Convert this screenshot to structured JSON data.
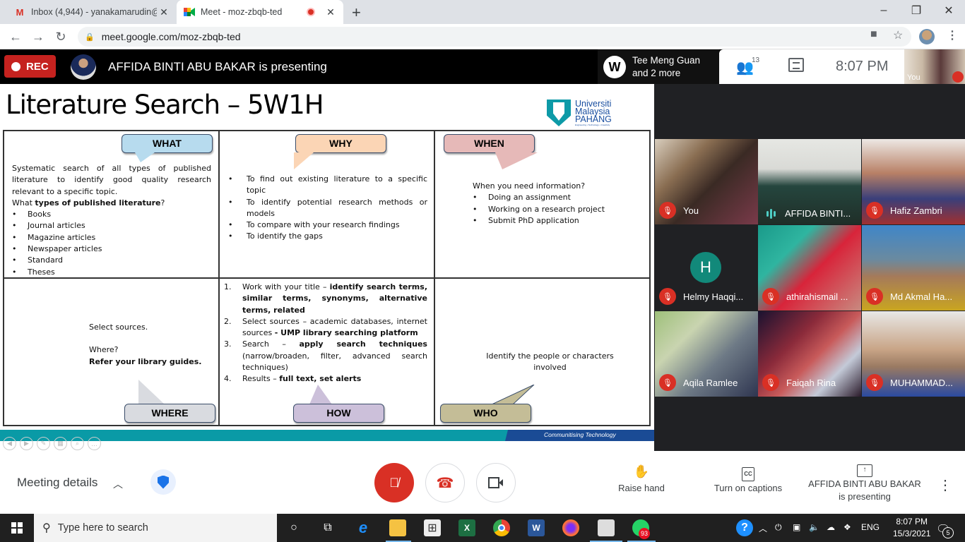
{
  "browser": {
    "tabs": [
      {
        "title": "Inbox (4,944) - yanakamarudin@",
        "icon": "gmail-icon",
        "active": false
      },
      {
        "title": "Meet - moz-zbqb-ted",
        "icon": "meet-icon",
        "active": true,
        "recording": true
      }
    ],
    "new_tab": "+",
    "url": "meet.google.com/moz-zbqb-ted",
    "window_controls": {
      "minimize": "–",
      "restore": "❐",
      "close": "✕"
    }
  },
  "meet": {
    "rec_label": "REC",
    "presenting_banner": "AFFIDA BINTI ABU BAKAR is presenting",
    "owner": {
      "name_line1": "Tee Meng Guan",
      "name_line2": "and 2 more"
    },
    "people_count": "13",
    "time": "8:07  PM",
    "self_label": "You",
    "participants": [
      {
        "name": "You",
        "muted": true,
        "bg": "linear-gradient(135deg,#d8cdbd 0%,#8a6e52 30%,#3a2a24 55%,#7a3a4a 100%)"
      },
      {
        "name": "AFFIDA BINTI...",
        "muted": false,
        "speaking": true,
        "bg": "linear-gradient(180deg,#e6e7e3 0%,#d9dad6 35%,#25463e 55%,#1f2e28 100%)"
      },
      {
        "name": "Hafiz Zambri",
        "muted": true,
        "bg": "linear-gradient(180deg,#ede8e4 0%,#b88066 40%,#3a3f7a 70%,#a03030 100%)"
      },
      {
        "name": "Helmy Haqqi...",
        "muted": true,
        "avatar_letter": "H",
        "bg": "#202124"
      },
      {
        "name": "athirahismail ...",
        "muted": true,
        "bg": "linear-gradient(135deg,#1a9a8a 0%,#2fb5a0 30%,#d8243a 55%,#c88a80 100%)"
      },
      {
        "name": "Md Akmal Ha...",
        "muted": true,
        "bg": "linear-gradient(180deg,#3f86c8 0%,#6a8aa0 40%,#a57a5a 60%,#c9a520 100%)"
      },
      {
        "name": "Aqila Ramlee",
        "muted": true,
        "bg": "linear-gradient(135deg,#9ec07a 0%,#c9d4b0 30%,#6e7a86 60%,#2e3550 100%)"
      },
      {
        "name": "Faiqah Rina",
        "muted": true,
        "bg": "linear-gradient(135deg,#1a1230 0%,#8a2a3a 35%,#c85a5a 55%,#c4cad8 75%,#2a1a2a 100%)"
      },
      {
        "name": "MUHAMMAD...",
        "muted": true,
        "bg": "linear-gradient(180deg,#e8e8e6 0%,#c8a486 45%,#9a7a62 65%,#2a4aa0 100%)"
      }
    ],
    "bottom_bar": {
      "meeting_details": "Meeting details",
      "raise_hand": "Raise hand",
      "captions": "Turn on captions",
      "presenting_line1": "AFFIDA BINTI ABU BAKAR",
      "presenting_line2": "is presenting"
    },
    "colors": {
      "red": "#d93025",
      "rec": "#c5221f",
      "blue": "#1a73e8"
    }
  },
  "slide": {
    "title": "Literature Search – 5W1H",
    "logo": {
      "line1": "Universiti",
      "line2": "Malaysia",
      "line3": "PAHANG",
      "tagline": "Engineering • Technology • Creativity"
    },
    "footer": "Communitising Technology",
    "what": {
      "label": "WHAT",
      "intro": "Systematic search of all types of published literature to identify good quality research relevant to a specific topic.",
      "question_prefix": "What ",
      "question_bold": "types of published literature",
      "question_suffix": "?",
      "items": [
        "Books",
        "Journal articles",
        "Magazine articles",
        "Newspaper articles",
        "Standard",
        "Theses"
      ]
    },
    "why": {
      "label": "WHY",
      "items": [
        "To find out existing literature to a specific topic",
        "To identify potential research methods or models",
        "To compare with your research findings",
        "To identify the gaps"
      ]
    },
    "when": {
      "label": "WHEN",
      "question": "When you need information?",
      "items": [
        "Doing an assignment",
        "Working on a research project",
        "Submit PhD application"
      ]
    },
    "where": {
      "label": "WHERE",
      "line1": "Select sources.",
      "line2": "Where?",
      "line3": "Refer your library guides."
    },
    "how": {
      "label": "HOW",
      "steps": [
        {
          "num": "1.",
          "text": "Work with your title – ",
          "bold": "identify search terms, similar terms, synonyms, alternative terms, related"
        },
        {
          "num": "2.",
          "text": "Select sources – academic databases, internet sources ",
          "bold": "- UMP library searching platform"
        },
        {
          "num": "3.",
          "text": "Search – ",
          "bold": "apply search techniques",
          "after": " (narrow/broaden, filter, advanced search techniques)"
        },
        {
          "num": "4.",
          "text": "Results – ",
          "bold": "full text, set alerts"
        }
      ]
    },
    "who": {
      "label": "WHO",
      "text": "Identify the people or characters involved"
    },
    "bubble_colors": {
      "what": "#b7dbee",
      "why": "#fbd5b5",
      "when": "#e6b9b8",
      "where": "#d9dbe0",
      "how": "#ccc0da",
      "who": "#c4bd97"
    }
  },
  "taskbar": {
    "search_placeholder": "Type here to search",
    "time": "8:07 PM",
    "date": "15/3/2021",
    "language": "ENG",
    "whatsapp_badge": "93",
    "notifications": "5"
  }
}
